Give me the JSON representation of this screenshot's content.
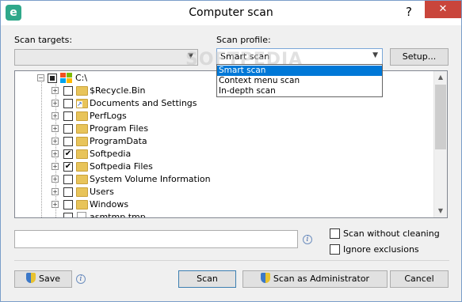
{
  "window": {
    "title": "Computer scan",
    "help_glyph": "?",
    "close_glyph": "✕",
    "app_icon_letter": "e"
  },
  "scan_targets": {
    "label": "Scan targets:",
    "value": ""
  },
  "scan_profile": {
    "label": "Scan profile:",
    "value": "Smart scan",
    "options": [
      "Smart scan",
      "Context menu scan",
      "In-depth scan"
    ],
    "selected_index": 0
  },
  "setup_button": "Setup...",
  "tree": {
    "root": {
      "label": "C:\\",
      "state": "partial"
    },
    "items": [
      {
        "label": "$Recycle.Bin",
        "checked": false,
        "shortcut": false
      },
      {
        "label": "Documents and Settings",
        "checked": false,
        "shortcut": true
      },
      {
        "label": "PerfLogs",
        "checked": false,
        "shortcut": false
      },
      {
        "label": "Program Files",
        "checked": false,
        "shortcut": false
      },
      {
        "label": "ProgramData",
        "checked": false,
        "shortcut": false
      },
      {
        "label": "Softpedia",
        "checked": true,
        "shortcut": false
      },
      {
        "label": "Softpedia Files",
        "checked": true,
        "shortcut": false
      },
      {
        "label": "System Volume Information",
        "checked": false,
        "shortcut": false
      },
      {
        "label": "Users",
        "checked": false,
        "shortcut": false
      },
      {
        "label": "Windows",
        "checked": false,
        "shortcut": false
      }
    ],
    "file_item": {
      "label": "asmtmp.tmp",
      "checked": false
    }
  },
  "path_input": {
    "value": ""
  },
  "options": {
    "scan_without_cleaning": "Scan without cleaning",
    "ignore_exclusions": "Ignore exclusions"
  },
  "buttons": {
    "save": "Save",
    "scan": "Scan",
    "scan_admin": "Scan as Administrator",
    "cancel": "Cancel"
  },
  "watermark": "SOFTPEDIA",
  "colors": {
    "accent": "#0078d7",
    "close": "#c9453b",
    "app_icon": "#2fa88a"
  }
}
